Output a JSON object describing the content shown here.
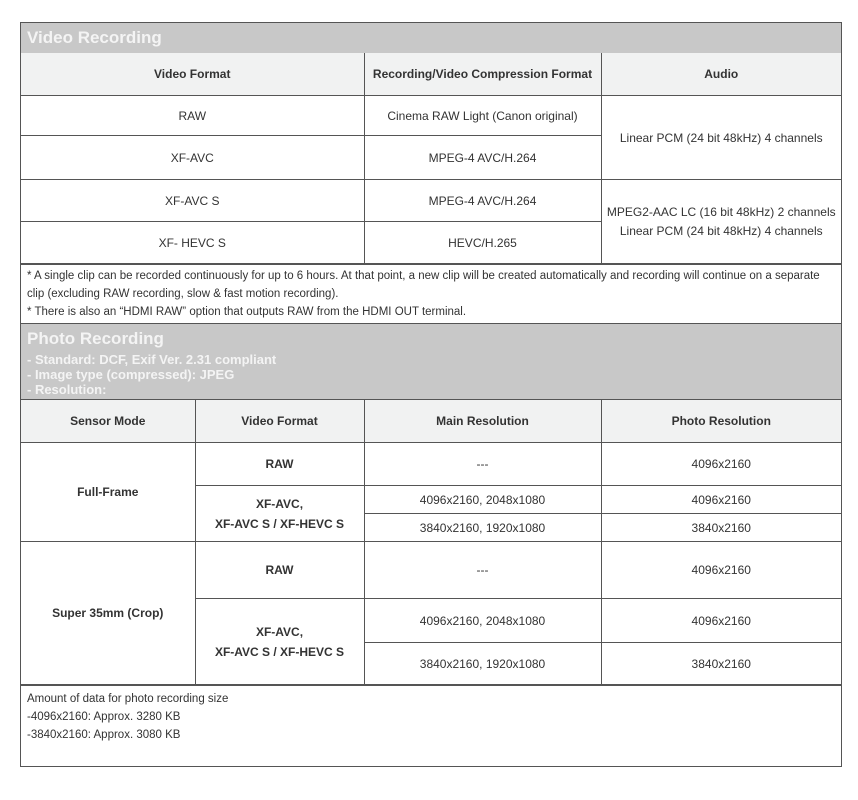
{
  "video": {
    "title": "Video Recording",
    "headers": [
      "Video Format",
      "Recording/Video Compression Format",
      "Audio"
    ],
    "rows": [
      {
        "format": "RAW",
        "compression": "Cinema RAW Light (Canon original)"
      },
      {
        "format": "XF-AVC",
        "compression": "MPEG-4 AVC/H.264"
      },
      {
        "format": "XF-AVC S",
        "compression": "MPEG-4 AVC/H.264"
      },
      {
        "format": "XF- HEVC S",
        "compression": "HEVC/H.265"
      }
    ],
    "audio_1": "Linear PCM (24 bit 48kHz) 4 channels",
    "audio_2a": "MPEG2-AAC LC (16 bit 48kHz) 2 channels",
    "audio_2b": "Linear PCM (24 bit 48kHz) 4 channels",
    "notes": [
      "* A single clip can be recorded continuously for up to 6 hours. At that point, a new clip will be created automatically and recording will continue on a separate clip (excluding RAW recording, slow & fast motion recording).",
      "* There is also an “HDMI RAW” option that outputs RAW from the HDMI OUT terminal."
    ]
  },
  "photo": {
    "title": "Photo Recording",
    "lines": [
      "- Standard: DCF, Exif Ver. 2.31 compliant",
      "- Image type (compressed): JPEG",
      "- Resolution:"
    ],
    "headers": [
      "Sensor Mode",
      "Video Format",
      "Main Resolution",
      "Photo Resolution"
    ],
    "full_frame": "Full-Frame",
    "super35": "Super 35mm (Crop)",
    "raw": "RAW",
    "xf_line1": "XF-AVC,",
    "xf_line2": "XF-AVC S / XF-HEVC S",
    "dash": "---",
    "res_a": "4096x2160, 2048x1080",
    "res_b": "3840x2160, 1920x1080",
    "photo_a": "4096x2160",
    "photo_b": "3840x2160",
    "notes": [
      "Amount of data for photo recording size",
      "-4096x2160: Approx. 3280 KB",
      "-3840x2160: Approx. 3080 KB"
    ]
  }
}
